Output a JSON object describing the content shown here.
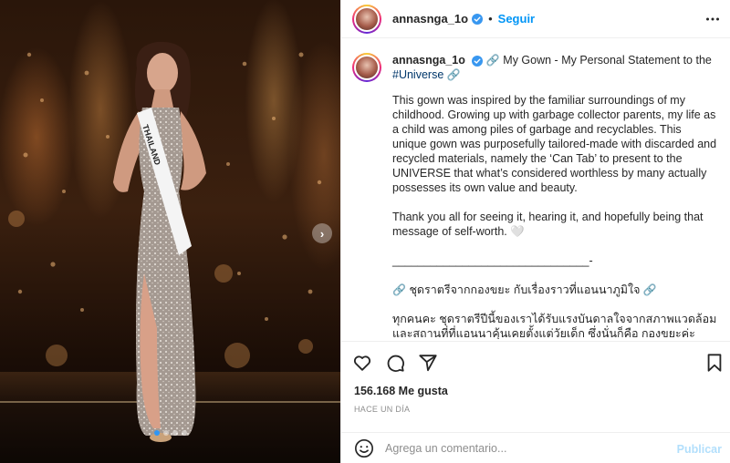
{
  "post": {
    "username": "annasnga_1o",
    "follow_label": "Seguir",
    "separator": "•"
  },
  "caption": {
    "username": "annasnga_1o",
    "title": "My Gown - My Personal Statement to the",
    "hashtag": "#Universe",
    "link_glyph": "🔗",
    "paragraph1": "This gown was inspired by the familiar surroundings of my childhood. Growing up with garbage collector parents, my life as a child was among piles of garbage and recyclables. This unique gown was purposefully tailored-made with discarded and recycled materials, namely the ‘Can Tab’ to present to the UNIVERSE that what’s considered worthless by many actually possesses its own value and beauty.",
    "paragraph2": "Thank you all for seeing it, hearing it, and hopefully being that message of self-worth. 🤍",
    "divider": "_______________________________-",
    "thai_title": "ชุดราตรีจากกองขยะ กับเรื่องราวที่แอนนาภูมิใจ",
    "thai_body": "ทุกคนคะ ชุดราตรีปีนี้ของเราได้รับแรงบันดาลใจจากสภาพแวดล้อมและสถานที่ที่แอนนาคุ้นเคยตั้งแต่วัยเด็ก ซึ่งนั่นก็คือ กองขยะค่ะ ด้วยความที่"
  },
  "media": {
    "sash_text": "THAILAND",
    "slide_count": 4,
    "active_slide": 1
  },
  "stats": {
    "likes": "156.168 Me gusta",
    "timestamp": "HACE UN DÍA"
  },
  "comment_box": {
    "placeholder": "Agrega un comentario...",
    "publish_label": "Publicar"
  },
  "colors": {
    "accent": "#0095f6",
    "publish_disabled": "#b2dffc",
    "verified": "#3897f0",
    "hashtag": "#00376b"
  },
  "icons": [
    "verified-icon",
    "more-options-icon",
    "heart-icon",
    "comment-icon",
    "share-icon",
    "bookmark-icon",
    "emoji-icon",
    "next-slide-icon"
  ]
}
